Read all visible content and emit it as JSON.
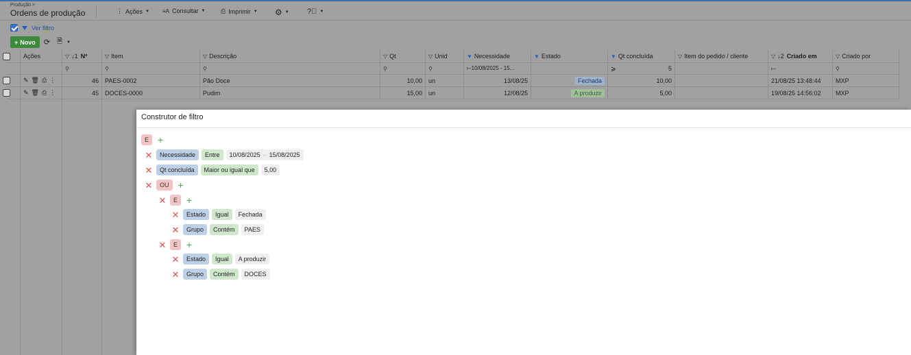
{
  "header": {
    "breadcrumb": "Produção >",
    "title": "Ordens de produção",
    "menus": [
      {
        "label": "Ações"
      },
      {
        "label": "Consultar"
      },
      {
        "label": "Imprimir"
      }
    ]
  },
  "filterbar": {
    "ver_filtro": "Ver filtro"
  },
  "toolbar": {
    "new_label": "Novo"
  },
  "grid": {
    "columns": [
      "Ações",
      "Nº",
      "Item",
      "Descrição",
      "Qt",
      "Unid",
      "Necessidade",
      "Estado",
      "Qt concluída",
      "Item do pedido / cliente",
      "Criado em",
      "Criado por"
    ],
    "sort_markers": {
      "n": "↓1",
      "created": "↓2"
    },
    "filter_row": {
      "necessidade": "⟝10/08/2025 - 15...",
      "qt_concluida_op": "⩾",
      "qt_concluida_val": "5",
      "criado_em": "⟝"
    },
    "rows": [
      {
        "n": "46",
        "item": "PAES-0002",
        "desc": "Pão Doce",
        "qt": "10,00",
        "unid": "un",
        "nec": "13/08/25",
        "estado": "Fechada",
        "qtc": "10,00",
        "pedido": "",
        "criado_em": "21/08/25 13:48:44",
        "criado_por": "MXP"
      },
      {
        "n": "45",
        "item": "DOCES-0000",
        "desc": "Pudim",
        "qt": "15,00",
        "unid": "un",
        "nec": "12/08/25",
        "estado": "A produzir",
        "qtc": "5,00",
        "pedido": "",
        "criado_em": "19/08/25 14:56:02",
        "criado_por": "MXP"
      }
    ]
  },
  "modal": {
    "title": "Construtor de filtro",
    "root_op": "E",
    "cond1": {
      "field": "Necessidade",
      "op": "Entre",
      "v1": "10/08/2025",
      "sep": "–",
      "v2": "15/08/2025"
    },
    "cond2": {
      "field": "Qt concluída",
      "op": "Maior ou igual que",
      "v": "5,00"
    },
    "or_op": "OU",
    "group1": {
      "op": "E",
      "c1": {
        "field": "Estado",
        "op": "Igual",
        "v": "Fechada"
      },
      "c2": {
        "field": "Grupo",
        "op": "Contém",
        "v": "PAES"
      }
    },
    "group2": {
      "op": "E",
      "c1": {
        "field": "Estado",
        "op": "Igual",
        "v": "A produzir"
      },
      "c2": {
        "field": "Grupo",
        "op": "Contém",
        "v": "DOCES"
      }
    }
  },
  "colors": {
    "accent": "#3a72c4",
    "new_button": "#3d8a3d",
    "delete": "#d9534f",
    "add": "#4aa74a"
  }
}
